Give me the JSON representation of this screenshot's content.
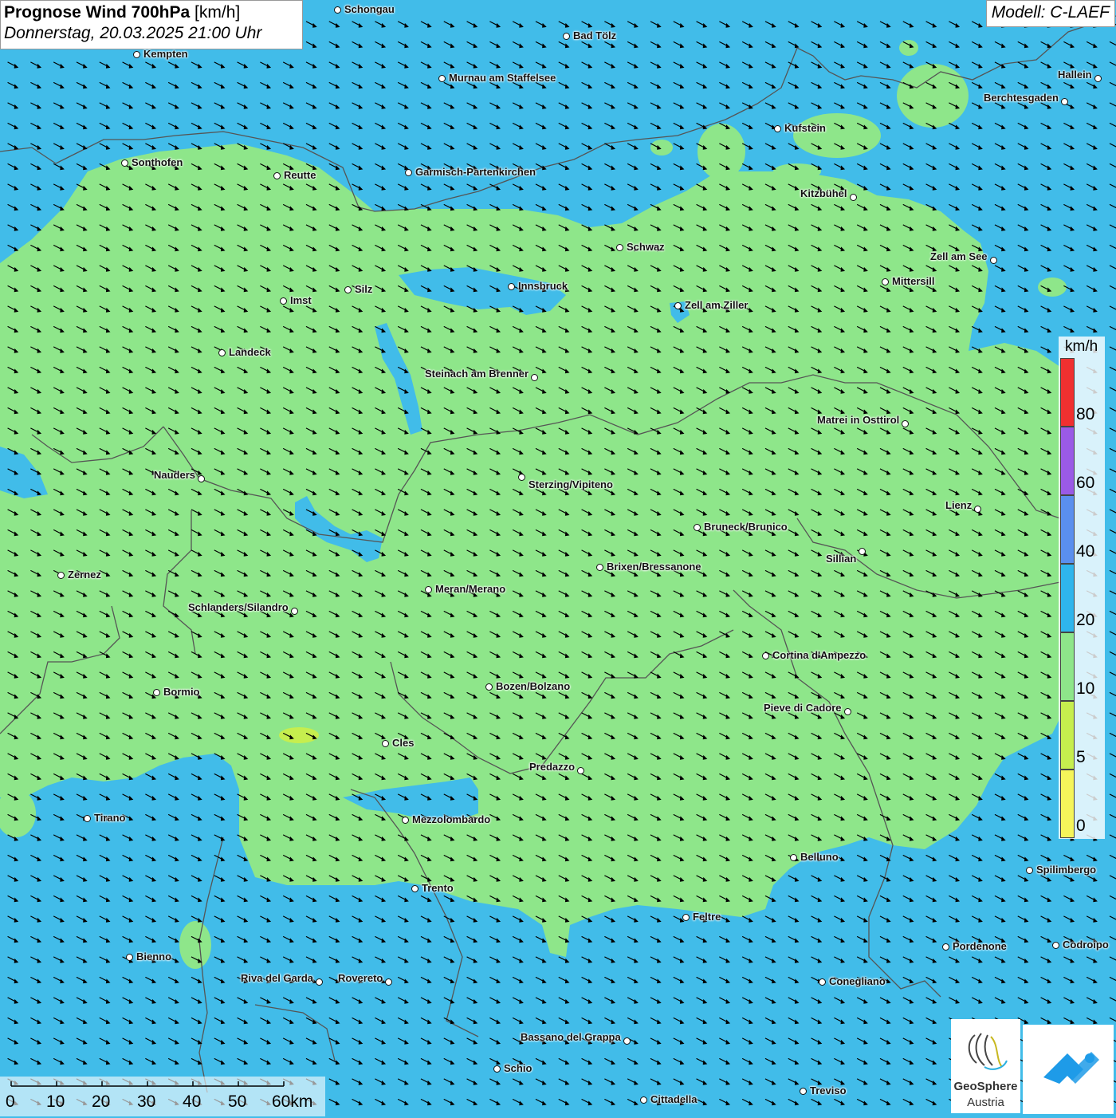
{
  "title": {
    "bold": "Prognose Wind 700hPa",
    "unit": " [km/h]",
    "date": "Donnerstag, 20.03.2025 21:00 Uhr"
  },
  "model": "Modell: C-LAEF",
  "legend": {
    "unit": "km/h",
    "ticks": [
      "80",
      "60",
      "40",
      "20",
      "10",
      "5",
      "0"
    ],
    "colors": [
      "#f03030",
      "#9a5ae6",
      "#5a8fee",
      "#2fb5ec",
      "#8ee68a",
      "#c6ee4e",
      "#f5f55a"
    ]
  },
  "scale": {
    "labels": [
      "0",
      "10",
      "20",
      "30",
      "40",
      "50",
      "60km"
    ]
  },
  "colors": {
    "wind_10_20": "#8ee68a",
    "wind_20_40": "#41bce9",
    "borders": "#555555"
  },
  "wind_arrows": {
    "direction": "east-southeast",
    "spacing_note": "uniform grid"
  },
  "logos": {
    "geosphere_name": "GeoSphere",
    "geosphere_sub": "Austria"
  },
  "cities": [
    {
      "name": "Schongau"
    },
    {
      "name": "Bad Tölz"
    },
    {
      "name": "Kempten"
    },
    {
      "name": "Murnau am Staffelsee"
    },
    {
      "name": "Hallein"
    },
    {
      "name": "Berchtesgaden"
    },
    {
      "name": "Kufstein"
    },
    {
      "name": "Sonthofen"
    },
    {
      "name": "Reutte"
    },
    {
      "name": "Garmisch-Partenkirchen"
    },
    {
      "name": "Kitzbühel"
    },
    {
      "name": "Schwaz"
    },
    {
      "name": "Zell am See"
    },
    {
      "name": "Mittersill"
    },
    {
      "name": "Innsbruck"
    },
    {
      "name": "Silz"
    },
    {
      "name": "Imst"
    },
    {
      "name": "Zell am Ziller"
    },
    {
      "name": "Landeck"
    },
    {
      "name": "Steinach am Brenner"
    },
    {
      "name": "Matrei in Osttirol"
    },
    {
      "name": "Nauders"
    },
    {
      "name": "Sterzing/Vipiteno"
    },
    {
      "name": "Lienz"
    },
    {
      "name": "Bruneck/Brunico"
    },
    {
      "name": "Sillian"
    },
    {
      "name": "Zernez"
    },
    {
      "name": "Brixen/Bressanone"
    },
    {
      "name": "Meran/Merano"
    },
    {
      "name": "Schlanders/Silandro"
    },
    {
      "name": "Cortina d'Ampezzo"
    },
    {
      "name": "Bormio"
    },
    {
      "name": "Bozen/Bolzano"
    },
    {
      "name": "Pieve di Cadore"
    },
    {
      "name": "Cles"
    },
    {
      "name": "Predazzo"
    },
    {
      "name": "Tirano"
    },
    {
      "name": "Mezzolombardo"
    },
    {
      "name": "Belluno"
    },
    {
      "name": "Spilimbergo"
    },
    {
      "name": "Trento"
    },
    {
      "name": "Feltre"
    },
    {
      "name": "Pordenone"
    },
    {
      "name": "Codroipo"
    },
    {
      "name": "Bienno"
    },
    {
      "name": "Riva del Garda"
    },
    {
      "name": "Rovereto"
    },
    {
      "name": "Conegliano"
    },
    {
      "name": "Bassano del Grappa"
    },
    {
      "name": "Schio"
    },
    {
      "name": "Treviso"
    },
    {
      "name": "Cittadella"
    }
  ]
}
